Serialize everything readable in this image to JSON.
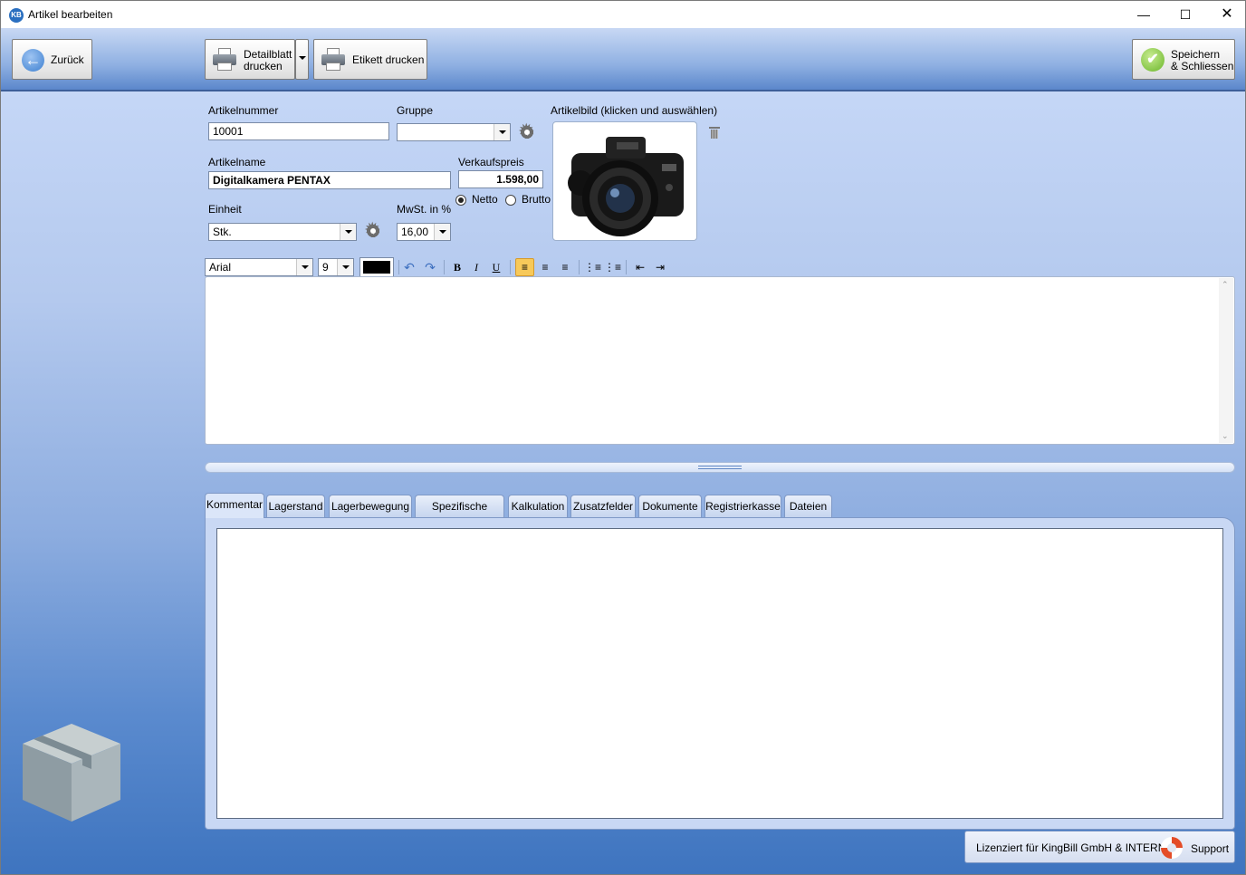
{
  "window": {
    "title": "Artikel bearbeiten",
    "icon_text": "KB"
  },
  "toolbar": {
    "back_label": "Zurück",
    "detail_label": "Detailblatt drucken",
    "detail_line1": "Detailblatt",
    "detail_line2": "drucken",
    "label_print": "Etikett drucken",
    "save_line1": "Speichern",
    "save_line2": "& Schliessen"
  },
  "form": {
    "article_number_label": "Artikelnummer",
    "article_number": "10001",
    "group_label": "Gruppe",
    "group_value": "",
    "image_label": "Artikelbild (klicken und auswählen)",
    "article_name_label": "Artikelname",
    "article_name": "Digitalkamera PENTAX",
    "price_label": "Verkaufspreis",
    "price": "1.598,00",
    "price_mode": {
      "netto": "Netto",
      "brutto": "Brutto",
      "selected": "Netto"
    },
    "unit_label": "Einheit",
    "unit_value": "Stk.",
    "vat_label": "MwSt. in %",
    "vat_value": "16,00"
  },
  "editor_toolbar": {
    "font": "Arial",
    "size": "9",
    "color": "#000000",
    "bold": "B",
    "italic": "I",
    "underline": "U"
  },
  "tabs": [
    {
      "label": "Kommentar",
      "active": true
    },
    {
      "label": "Lagerstand"
    },
    {
      "label": "Lagerbewegung"
    },
    {
      "label": "Spezifische Preise"
    },
    {
      "label": "Kalkulation"
    },
    {
      "label": "Zusatzfelder"
    },
    {
      "label": "Dokumente"
    },
    {
      "label": "Registrierkasse"
    },
    {
      "label": "Dateien"
    }
  ],
  "status": {
    "license": "Lizenziert für KingBill GmbH & INTERN",
    "support": "Support"
  },
  "colors": {
    "accent": "#3e74bf",
    "selected_tool": "#f7c95a"
  }
}
